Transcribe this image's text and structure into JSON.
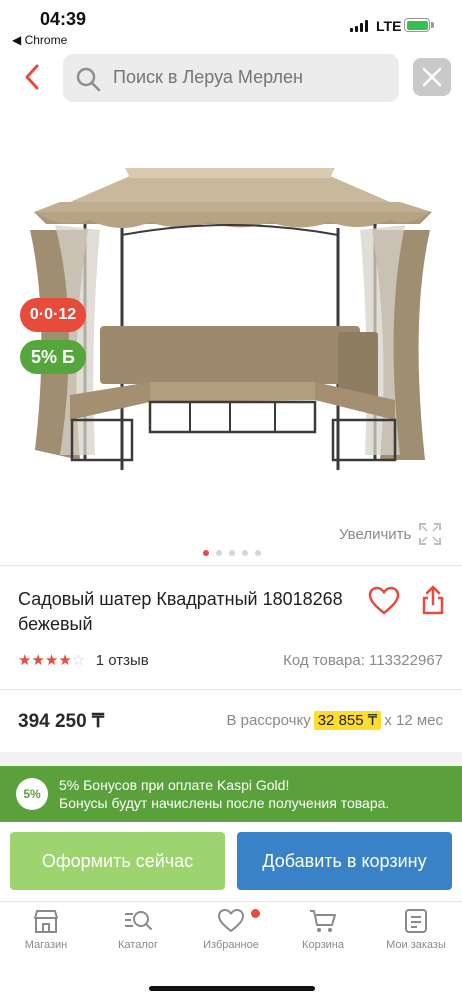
{
  "status_bar": {
    "time": "04:39",
    "back_app": "◀ Chrome",
    "network": "LTE"
  },
  "search": {
    "placeholder": "Поиск в Леруа Мерлен"
  },
  "gallery": {
    "badge_sale": "0·0·12",
    "badge_bonus": "5% Б",
    "zoom_label": "Увеличить",
    "dot_count": 5,
    "active_dot": 0
  },
  "product": {
    "title": "Садовый шатер Квадратный 18018268 бежевый",
    "rating": 4,
    "rating_max": 5,
    "reviews": "1 отзыв",
    "sku": "Код товара: 113322967",
    "price": "394 250 ₸",
    "installment_prefix": "В рассрочку",
    "installment_amount": "32 855 ₸",
    "installment_suffix": "x 12 мес"
  },
  "bonus": {
    "badge": "5%",
    "line1": "5% Бонусов при оплате Kaspi Gold!",
    "line2": "Бонусы будут начислены после получения товара."
  },
  "actions": {
    "buy_now": "Оформить сейчас",
    "add_to_cart": "Добавить в корзину"
  },
  "tabs": [
    {
      "label": "Магазин",
      "icon": "shop-icon"
    },
    {
      "label": "Каталог",
      "icon": "catalog-search-icon"
    },
    {
      "label": "Избранное",
      "icon": "heart-icon"
    },
    {
      "label": "Корзина",
      "icon": "cart-icon"
    },
    {
      "label": "Мои заказы",
      "icon": "orders-icon"
    }
  ],
  "colors": {
    "accent_red": "#e84a3c",
    "kaspi_green": "#5aa13c",
    "buy_green": "#9ed46f",
    "cart_blue": "#3a82c8",
    "highlight_yellow": "#ffdc2e"
  }
}
